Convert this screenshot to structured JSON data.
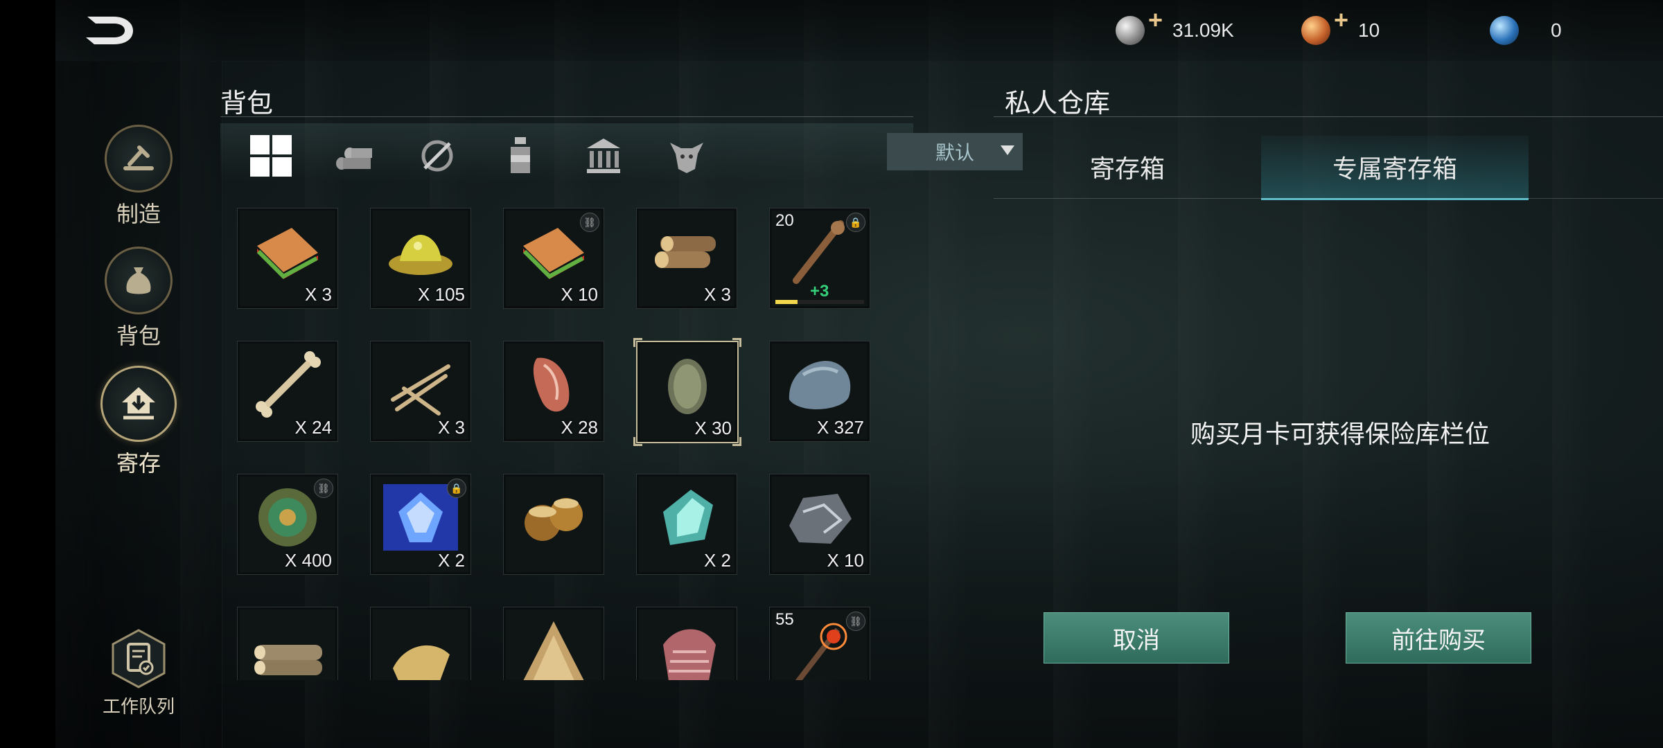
{
  "header": {
    "currencies": [
      {
        "icon": "silver-coin-icon",
        "value": "31.09K"
      },
      {
        "icon": "copper-coin-icon",
        "value": "10"
      },
      {
        "icon": "blue-gem-icon",
        "value": "0"
      }
    ]
  },
  "sidebar": {
    "items": [
      {
        "label": "制造",
        "icon": "craft-hammer-icon"
      },
      {
        "label": "背包",
        "icon": "bag-icon"
      },
      {
        "label": "寄存",
        "icon": "deposit-house-icon"
      }
    ],
    "queue_label": "工作队列"
  },
  "backpack": {
    "title": "背包",
    "filters": [
      "all-grid-icon",
      "logs-icon",
      "weapon-icon",
      "potion-icon",
      "building-icon",
      "creature-icon"
    ],
    "sort_label": "默认",
    "items": [
      {
        "name": "sandwich",
        "qty": "X 3"
      },
      {
        "name": "yellow-jelly",
        "qty": "X 105"
      },
      {
        "name": "sandwich",
        "qty": "X 10",
        "linked": true
      },
      {
        "name": "logs",
        "qty": "X 3"
      },
      {
        "name": "wooden-club",
        "level": "20",
        "plus": "+3",
        "locked": true,
        "durability": 0.25
      },
      {
        "name": "bone",
        "qty": "X 24"
      },
      {
        "name": "branches",
        "qty": "X 3"
      },
      {
        "name": "raw-meat",
        "qty": "X 28"
      },
      {
        "name": "scale-leaf",
        "qty": "X 30",
        "selected": true
      },
      {
        "name": "stone",
        "qty": "X 327"
      },
      {
        "name": "jade-coin",
        "qty": "X 400",
        "linked": true
      },
      {
        "name": "blue-crystal-orb",
        "qty": "X 2",
        "locked": true
      },
      {
        "name": "nuts",
        "qty": ""
      },
      {
        "name": "cyan-crystal",
        "qty": "X 2"
      },
      {
        "name": "iron-ore",
        "qty": "X 10"
      },
      {
        "name": "log-bundle",
        "qty": ""
      },
      {
        "name": "straw",
        "qty": ""
      },
      {
        "name": "pine",
        "qty": ""
      },
      {
        "name": "ribs",
        "qty": ""
      },
      {
        "name": "fire-staff",
        "level": "55",
        "linked": true
      }
    ]
  },
  "storage": {
    "title": "私人仓库",
    "tabs": [
      "寄存箱",
      "专属寄存箱"
    ],
    "notice": "购买月卡可获得保险库栏位",
    "cancel_label": "取消",
    "buy_label": "前往购买"
  }
}
